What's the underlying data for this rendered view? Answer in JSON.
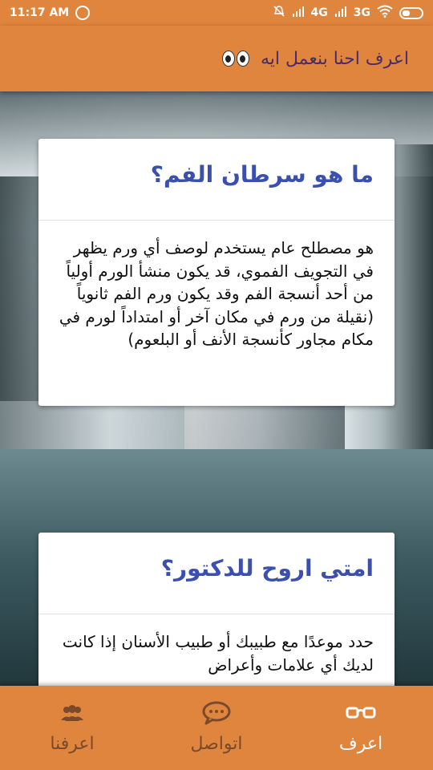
{
  "status_bar": {
    "time": "11:17 AM",
    "network1": "4G",
    "network2": "3G"
  },
  "app_bar": {
    "title": "اعرف احنا بنعمل ايه"
  },
  "cards": [
    {
      "title": "ما هو سرطان الفم؟",
      "body": "هو مصطلح عام يستخدم لوصف أي ورم يظهر في التجويف الفموي، قد يكون منشأ الورم أولياً من أحد أنسجة الفم وقد يكون ورم الفم ثانوياً (نقيلة من ورم في مكان آخر أو امتداداً لورم في مكام مجاور كأنسجة الأنف أو البلعوم)"
    },
    {
      "title": "امتي اروح للدكتور؟",
      "body": "حدد موعدًا مع طبيبك أو طبيب الأسنان إذا كانت لديك أي علامات وأعراض"
    }
  ],
  "bottom_nav": {
    "items": [
      {
        "label": "اعرف",
        "icon": "glasses-icon",
        "active": true
      },
      {
        "label": "اتواصل",
        "icon": "chat-bubble-icon",
        "active": false
      },
      {
        "label": "اعرفنا",
        "icon": "people-icon",
        "active": false
      }
    ]
  },
  "colors": {
    "primary": "#e0853d",
    "title_text": "#4a2b6a",
    "card_title": "#3a4fae",
    "nav_inactive": "#7a4a2c",
    "nav_active": "#ffffff"
  }
}
